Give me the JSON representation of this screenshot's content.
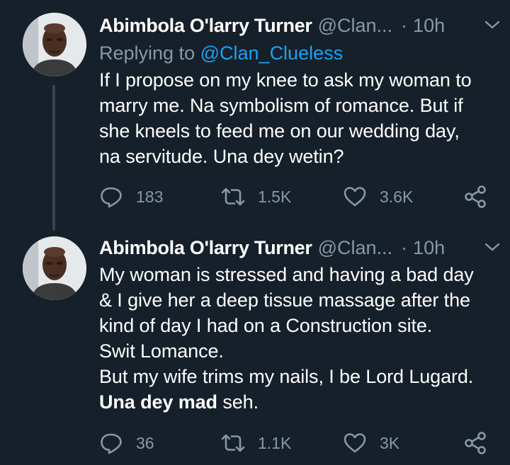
{
  "tweets": [
    {
      "display_name": "Abimbola O'larry Turner",
      "handle": "@Clan...",
      "separator": "·",
      "time": "10h",
      "reply_prefix": "Replying to",
      "reply_mention": "@Clan_Clueless",
      "text_lines": [
        "If I propose on my knee to ask my woman to",
        "marry me. Na symbolism of romance. But if",
        "she kneels to feed me on our wedding day,",
        "na servitude. Una dey wetin?"
      ],
      "replies": "183",
      "retweets": "1.5K",
      "likes": "3.6K"
    },
    {
      "display_name": "Abimbola O'larry Turner",
      "handle": "@Clan...",
      "separator": "·",
      "time": "10h",
      "text_lines": [
        "My woman is stressed and having a bad day",
        "& I give her a deep tissue massage after the",
        "kind of day I had on a Construction site.",
        "Swit Lomance.",
        "But my wife trims my nails, I be Lord Lugard."
      ],
      "last_line_bold": "Una dey mad",
      "last_line_rest": " seh.",
      "replies": "36",
      "retweets": "1.1K",
      "likes": "3K"
    }
  ],
  "icons": {
    "avatar": "profile-photo",
    "menu": "chevron-down-icon",
    "reply": "reply-icon",
    "retweet": "retweet-icon",
    "like": "heart-icon",
    "share": "share-icon"
  },
  "colors": {
    "background": "#15202b",
    "text": "#ffffff",
    "secondary": "#8899a6",
    "link": "#1da1f2",
    "thread_line": "#38444d"
  }
}
